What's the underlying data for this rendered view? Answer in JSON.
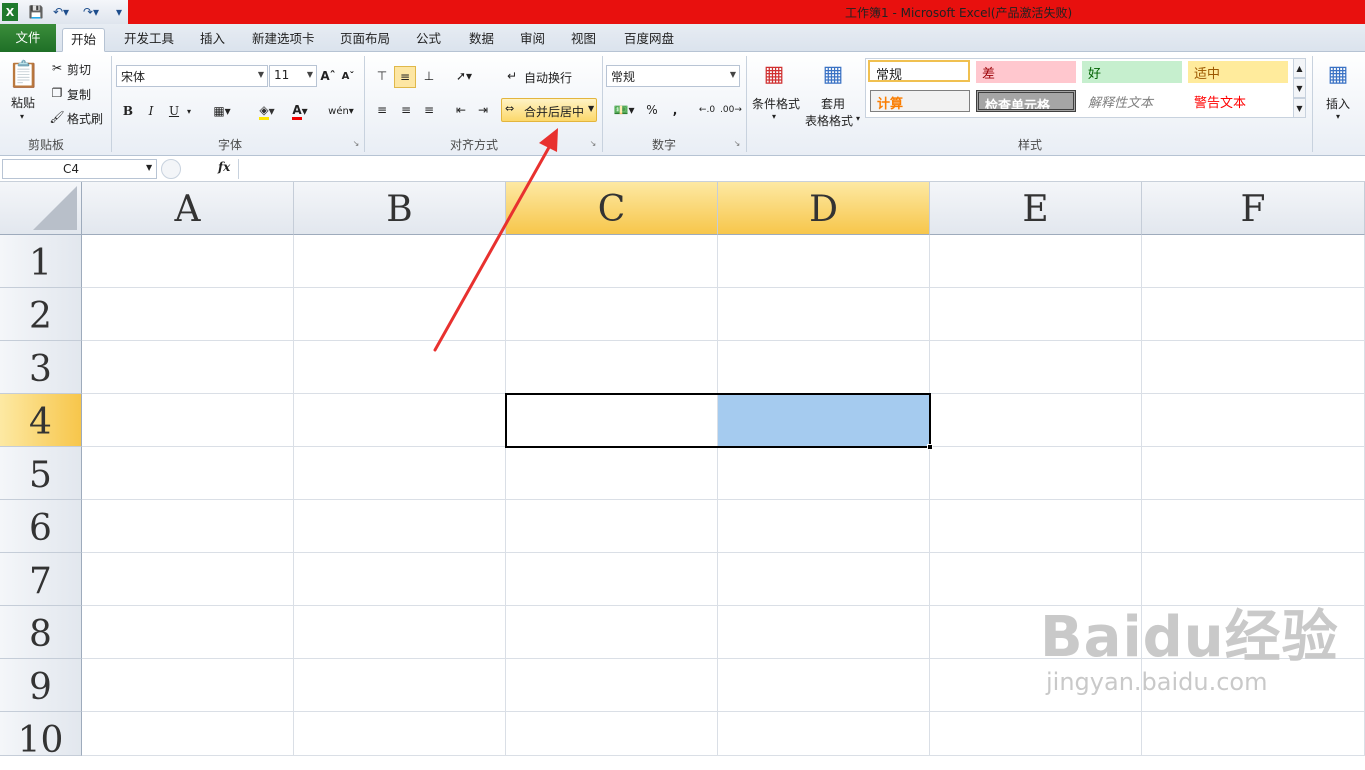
{
  "window": {
    "title": "工作簿1 - Microsoft Excel(产品激活失败)"
  },
  "tabs": [
    "文件",
    "开始",
    "开发工具",
    "插入",
    "新建选项卡",
    "页面布局",
    "公式",
    "数据",
    "审阅",
    "视图",
    "百度网盘"
  ],
  "clipboard": {
    "paste": "粘贴",
    "cut": "剪切",
    "copy": "复制",
    "format_painter": "格式刷",
    "group": "剪贴板"
  },
  "font": {
    "name": "宋体",
    "size": "11",
    "bold": "B",
    "italic": "I",
    "underline": "U",
    "group": "字体"
  },
  "alignment": {
    "wrap": "自动换行",
    "merge": "合并后居中",
    "group": "对齐方式"
  },
  "number": {
    "format": "常规",
    "percent": "%",
    "comma": ",",
    "group": "数字"
  },
  "styles": {
    "conditional": "条件格式",
    "table_line1": "套用",
    "table_line2": "表格格式",
    "group": "样式",
    "cells": [
      "常规",
      "差",
      "好",
      "适中",
      "计算",
      "检查单元格",
      "解释性文本",
      "警告文本"
    ]
  },
  "cells_group": {
    "insert": "插入"
  },
  "formula": {
    "name_box": "C4",
    "fx": "fx",
    "value": ""
  },
  "sheet": {
    "columns": [
      "A",
      "B",
      "C",
      "D",
      "E",
      "F"
    ],
    "rows": [
      "1",
      "2",
      "3",
      "4",
      "5",
      "6",
      "7",
      "8",
      "9",
      "10"
    ],
    "selected_cell": "C4"
  },
  "watermark": {
    "brand": "Baidu经验",
    "url": "jingyan.baidu.com"
  },
  "colors": {
    "file_tab": "#2a7d2e",
    "title_red": "#e8100e",
    "selected_header": "#f7c64b",
    "selection_fill": "#a5cbef",
    "arrow": "#e8312f"
  }
}
